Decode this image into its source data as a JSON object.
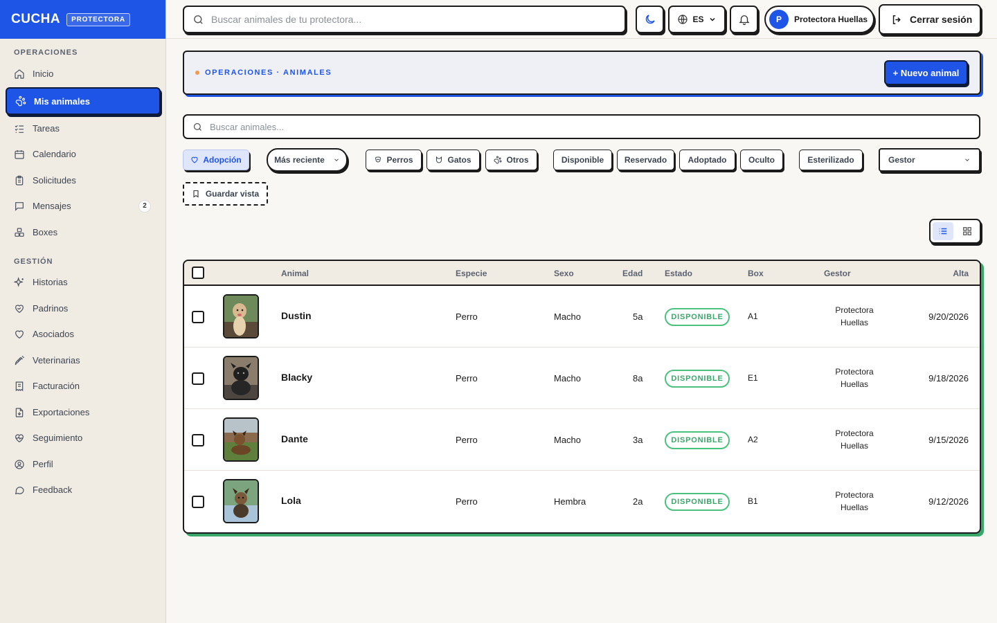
{
  "brand": {
    "logo": "CUCHA",
    "tag": "PROTECTORA"
  },
  "sidebar": {
    "sections": [
      "OPERACIONES",
      "GESTIÓN"
    ],
    "items": [
      {
        "label": "Inicio",
        "icon": "home-icon"
      },
      {
        "label": "Mis animales",
        "icon": "paw-icon",
        "active": true
      },
      {
        "label": "Tareas",
        "icon": "list-checks-icon"
      },
      {
        "label": "Calendario",
        "icon": "calendar-icon"
      },
      {
        "label": "Solicitudes",
        "icon": "clipboard-icon"
      },
      {
        "label": "Mensajes",
        "icon": "message-icon",
        "badge": "2"
      },
      {
        "label": "Boxes",
        "icon": "boxes-icon"
      },
      {
        "label": "Historias",
        "icon": "sparkles-icon"
      },
      {
        "label": "Padrinos",
        "icon": "heart-handshake-icon"
      },
      {
        "label": "Asociados",
        "icon": "heart-icon"
      },
      {
        "label": "Veterinarias",
        "icon": "syringe-icon"
      },
      {
        "label": "Facturación",
        "icon": "receipt-icon"
      },
      {
        "label": "Exportaciones",
        "icon": "file-download-icon"
      },
      {
        "label": "Seguimiento",
        "icon": "heart-pulse-icon"
      },
      {
        "label": "Perfil",
        "icon": "user-circle-icon"
      },
      {
        "label": "Feedback",
        "icon": "message-circle-icon"
      }
    ]
  },
  "topbar": {
    "search_placeholder": "Buscar animales de tu protectora...",
    "language": "ES",
    "user_initial": "P",
    "user_name": "Protectora Huellas",
    "logout_label": "Cerrar sesión"
  },
  "banner": {
    "breadcrumb": "OPERACIONES · ANIMALES",
    "new_button": "+ Nuevo animal"
  },
  "table_search": {
    "placeholder": "Buscar animales..."
  },
  "filters": {
    "adopcion": "Adopción",
    "sort": "Más reciente",
    "species": [
      "Perros",
      "Gatos",
      "Otros"
    ],
    "status": [
      "Disponible",
      "Reservado",
      "Adoptado",
      "Oculto"
    ],
    "sterilized": "Esterilizado",
    "gestor": "Gestor",
    "save_view": "Guardar vista"
  },
  "table": {
    "headers": {
      "animal": "Animal",
      "species": "Especie",
      "sex": "Sexo",
      "age": "Edad",
      "status": "Estado",
      "box": "Box",
      "gestor": "Gestor",
      "alta": "Alta"
    },
    "rows": [
      {
        "name": "Dustin",
        "species": "Perro",
        "sex": "Macho",
        "age": "5a",
        "status": "DISPONIBLE",
        "box": "A1",
        "gestor_l1": "Protectora",
        "gestor_l2": "Huellas",
        "alta": "9/20/2026"
      },
      {
        "name": "Blacky",
        "species": "Perro",
        "sex": "Macho",
        "age": "8a",
        "status": "DISPONIBLE",
        "box": "E1",
        "gestor_l1": "Protectora",
        "gestor_l2": "Huellas",
        "alta": "9/18/2026"
      },
      {
        "name": "Dante",
        "species": "Perro",
        "sex": "Macho",
        "age": "3a",
        "status": "DISPONIBLE",
        "box": "A2",
        "gestor_l1": "Protectora",
        "gestor_l2": "Huellas",
        "alta": "9/15/2026"
      },
      {
        "name": "Lola",
        "species": "Perro",
        "sex": "Hembra",
        "age": "2a",
        "status": "DISPONIBLE",
        "box": "B1",
        "gestor_l1": "Protectora",
        "gestor_l2": "Huellas",
        "alta": "9/12/2026"
      }
    ]
  },
  "colors": {
    "accent": "#1f55e6",
    "status_green": "#3aa76a",
    "sidebar_bg": "#f1ece3"
  }
}
